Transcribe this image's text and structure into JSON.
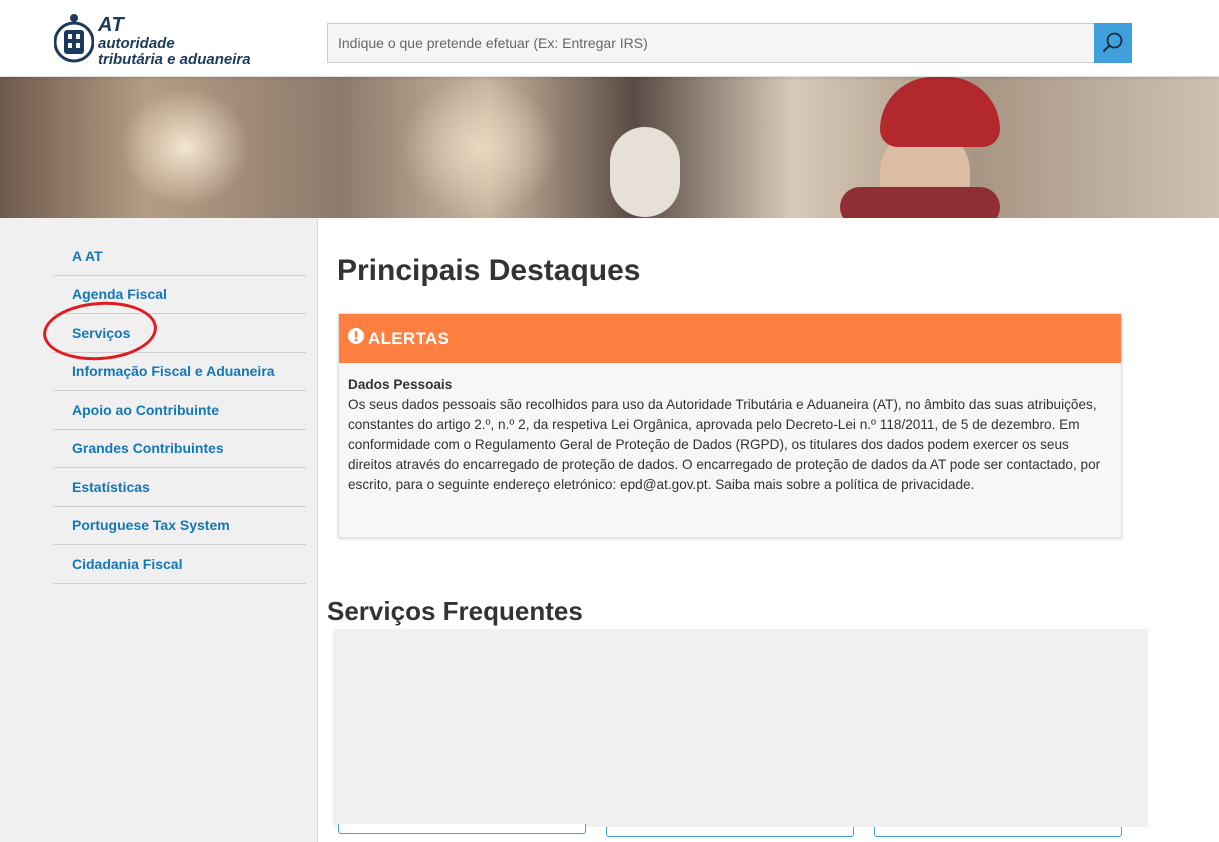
{
  "header": {
    "logo": {
      "abbr": "AT",
      "line1": "autoridade",
      "line2": "tributária e aduaneira"
    },
    "search": {
      "placeholder": "Indique o que pretende efetuar (Ex: Entregar IRS)",
      "button_icon": "search-icon"
    }
  },
  "sidebar": {
    "items": [
      {
        "label": "A AT"
      },
      {
        "label": "Agenda Fiscal"
      },
      {
        "label": "Serviços"
      },
      {
        "label": "Informação Fiscal e Aduaneira"
      },
      {
        "label": "Apoio ao Contribuinte"
      },
      {
        "label": "Grandes Contribuintes"
      },
      {
        "label": "Estatísticas"
      },
      {
        "label": "Portuguese Tax System"
      },
      {
        "label": "Cidadania Fiscal"
      }
    ],
    "highlighted_item": "Serviços"
  },
  "main": {
    "title": "Principais Destaques",
    "alert": {
      "icon": "exclamation-circle-icon",
      "title": "ALERTAS",
      "subtitle": "Dados Pessoais",
      "body": "Os seus dados pessoais são recolhidos para uso da Autoridade Tributária e Aduaneira (AT), no âmbito das suas atribuições, constantes do artigo 2.º, n.º 2, da respetiva Lei Orgânica, aprovada pelo Decreto-Lei n.º 118/2011, de 5 de dezembro. Em conformidade com o Regulamento Geral de Proteção de Dados (RGPD), os titulares dos dados podem exercer os seus direitos através do encarregado de proteção de dados. O encarregado de proteção de dados da AT pode ser contactado, por escrito, para o seguinte endereço eletrónico: epd@at.gov.pt. Saiba mais sobre a política de privacidade."
    },
    "frequent_title": "Serviços Frequentes"
  },
  "colors": {
    "accent_blue": "#1577b8",
    "search_button": "#3fa0db",
    "alert_orange": "#ff7f40",
    "highlight_red": "#e01b22"
  }
}
